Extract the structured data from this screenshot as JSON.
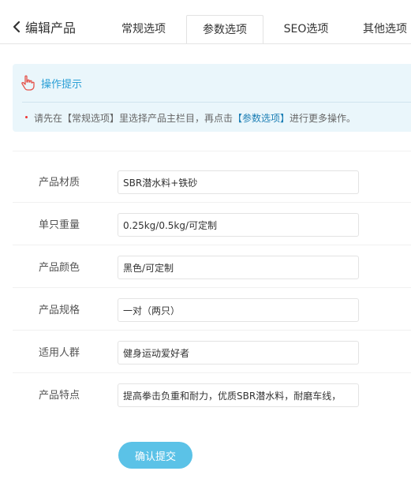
{
  "header": {
    "back_title": "编辑产品",
    "tabs": [
      {
        "label": "常规选项"
      },
      {
        "label": "参数选项"
      },
      {
        "label": "SEO选项"
      },
      {
        "label": "其他选项"
      }
    ],
    "active_tab": "参数选项"
  },
  "tip": {
    "title": "操作提示",
    "text_before": "请先在【常规选项】里选择产品主栏目，再点击",
    "text_highlight": "【参数选项】",
    "text_after": "进行更多操作。"
  },
  "form": {
    "fields": [
      {
        "label": "产品材质",
        "value": "SBR潜水料+铁砂"
      },
      {
        "label": "单只重量",
        "value": "0.25kg/0.5kg/可定制"
      },
      {
        "label": "产品颜色",
        "value": "黑色/可定制"
      },
      {
        "label": "产品规格",
        "value": "一对（两只）"
      },
      {
        "label": "适用人群",
        "value": "健身运动爱好者"
      },
      {
        "label": "产品特点",
        "value": "提高拳击负重和耐力，优质SBR潜水料，耐磨车线，"
      }
    ],
    "submit_label": "确认提交"
  },
  "icons": {
    "back": "chevron-left-icon",
    "tip": "pointing-hand-icon"
  },
  "colors": {
    "accent": "#2a9fd6",
    "submit": "#5bc2e7",
    "tip_bg": "#eaf6fb"
  }
}
